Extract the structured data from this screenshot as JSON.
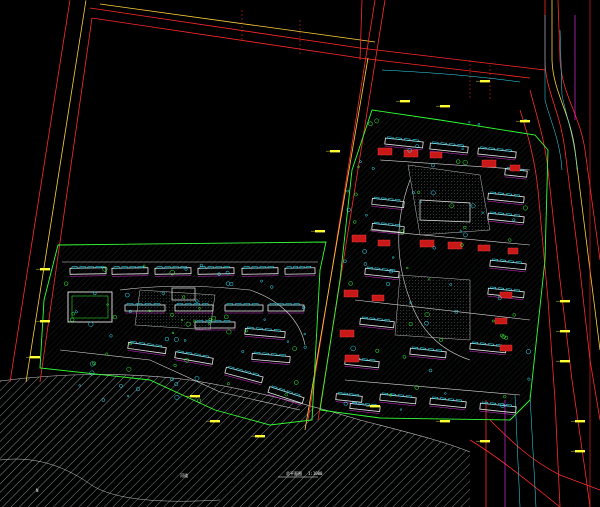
{
  "drawing": {
    "background": "#000000",
    "colors": {
      "road_red": "#ff2a2a",
      "road_yellow": "#ffd23a",
      "boundary_green": "#33ff33",
      "building_white": "#e8e8e8",
      "building_cyan": "#33e8ff",
      "accent_magenta": "#ff33ff",
      "parking_red": "#d01818",
      "hatch_gray": "#6a7070",
      "water_hatch": "#9aa3a3",
      "label_yellow": "#ffff33"
    },
    "labels": {
      "scale_title": "总平面图",
      "scale_ratio": "1:1000",
      "river_label": "河道",
      "corner_mark": "N"
    }
  }
}
